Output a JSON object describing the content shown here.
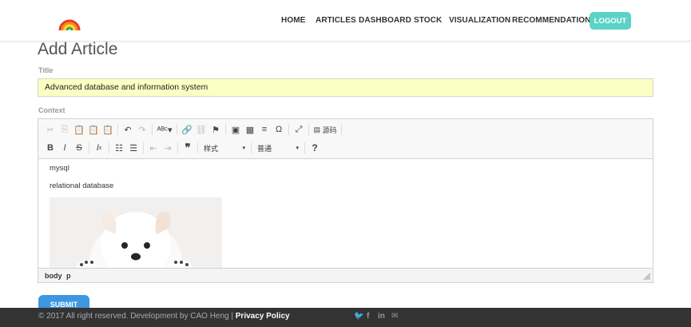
{
  "nav": {
    "links": [
      "HOME",
      "ARTICLES",
      "DASHBOARD",
      "STOCK",
      "VISUALIZATION",
      "RECOMMENDATION"
    ],
    "logout_label": "LOGOUT",
    "logout_color": "#5bd3c7"
  },
  "page": {
    "title": "Add Article",
    "title_label": "Title",
    "title_value": "Advanced database and information system",
    "context_label": "Context"
  },
  "editor": {
    "toolbar_row1": [
      "cut-icon",
      "copy-icon",
      "paste-icon",
      "paste-text-icon",
      "paste-word-icon",
      "undo-icon",
      "redo-icon",
      "spellcheck-icon",
      "link-icon",
      "unlink-icon",
      "anchor-icon",
      "image-icon",
      "table-icon",
      "horizontal-rule-icon",
      "special-char-icon",
      "maximize-icon"
    ],
    "source_label": "源码",
    "styles_label": "样式",
    "format_label": "普通",
    "help_label": "?",
    "content_lines": [
      "mysql",
      "relational database"
    ],
    "path": [
      "body",
      "p"
    ]
  },
  "form": {
    "submit_label": "SUBMIT",
    "submit_color": "#3c96e0"
  },
  "footer": {
    "copyright": "© 2017 All right reserved. Development by CAO Heng | ",
    "policy": "Privacy Policy",
    "social_icons": [
      "twitter-icon",
      "facebook-icon",
      "linkedin-icon",
      "mail-icon"
    ]
  }
}
